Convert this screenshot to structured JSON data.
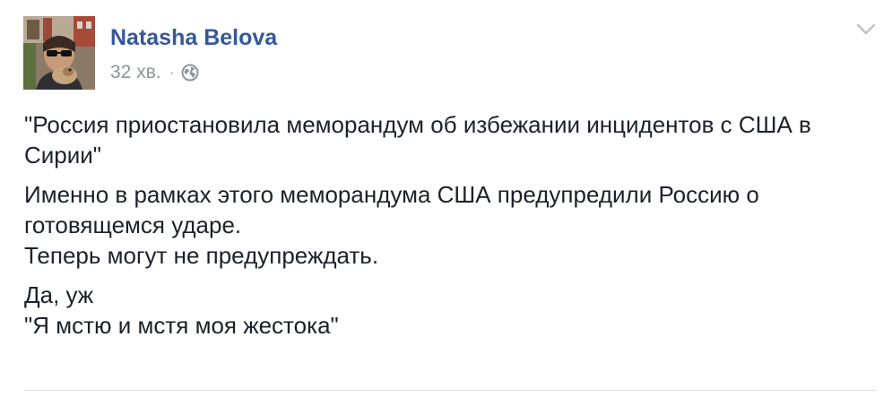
{
  "post": {
    "author": "Natasha Belova",
    "time": "32 хв.",
    "separator": "·",
    "privacy_icon": "globe-icon",
    "menu_icon": "chevron-down-icon",
    "paragraphs": [
      [
        "\"Россия приостановила меморандум об избежании инцидентов с США в",
        "Сирии\""
      ],
      [
        "Именно в рамках этого меморандума США предупредили Россию о",
        "готовящемся ударе.",
        "Теперь могут не предупреждать."
      ],
      [
        "Да, уж",
        "\"Я мстю и мстя моя жестока\""
      ]
    ]
  },
  "colors": {
    "author": "#365899",
    "meta": "#90949c",
    "text": "#1d2129",
    "divider": "#dddfe2"
  }
}
